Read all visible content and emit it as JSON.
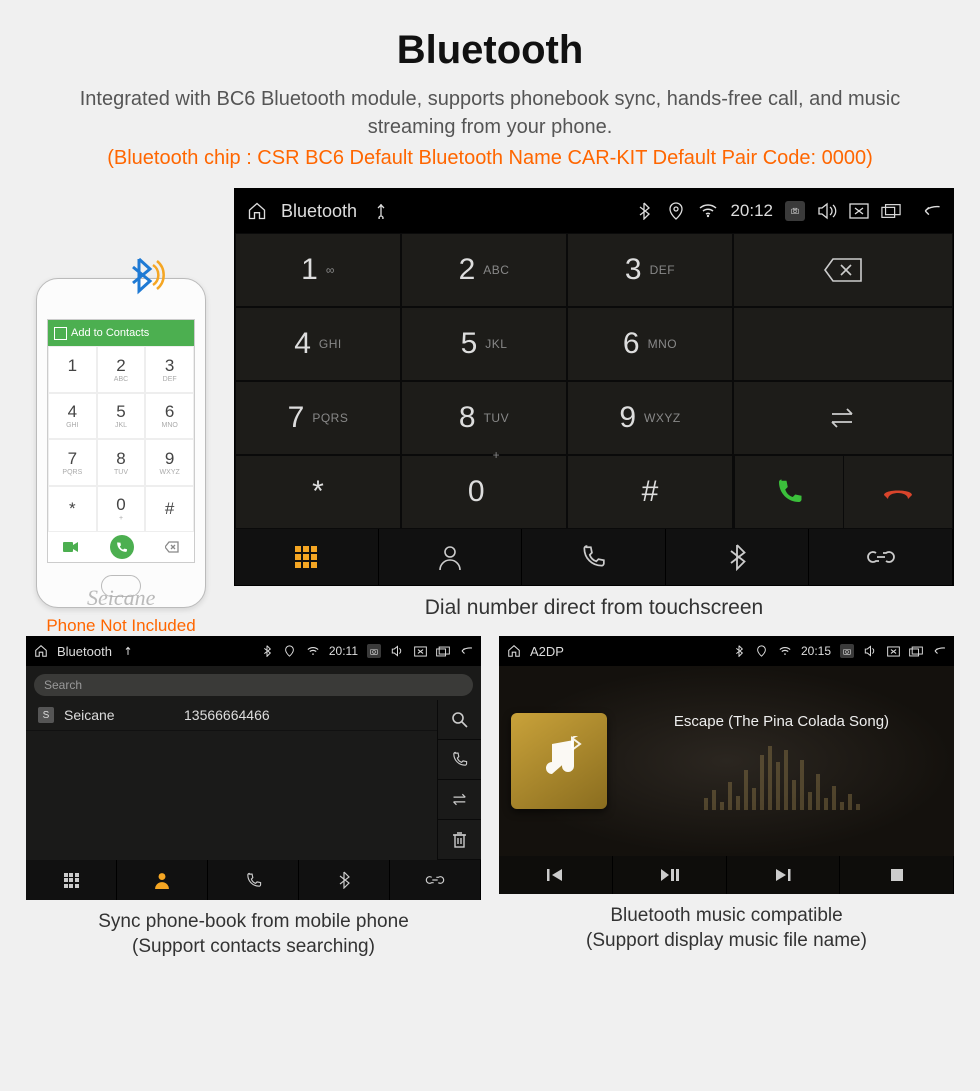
{
  "header": {
    "title": "Bluetooth",
    "description": "Integrated with BC6 Bluetooth module, supports phonebook sync, hands-free call, and music streaming from your phone.",
    "specs": "(Bluetooth chip : CSR BC6     Default Bluetooth Name CAR-KIT     Default Pair Code: 0000)"
  },
  "phone": {
    "topbar_label": "Add to Contacts",
    "caption": "Phone Not Included",
    "watermark": "Seicane"
  },
  "dialer": {
    "status": {
      "title": "Bluetooth",
      "time": "20:12"
    },
    "keys": [
      {
        "num": "1",
        "lbl": "∞"
      },
      {
        "num": "2",
        "lbl": "ABC"
      },
      {
        "num": "3",
        "lbl": "DEF"
      },
      {
        "num": "4",
        "lbl": "GHI"
      },
      {
        "num": "5",
        "lbl": "JKL"
      },
      {
        "num": "6",
        "lbl": "MNO"
      },
      {
        "num": "7",
        "lbl": "PQRS"
      },
      {
        "num": "8",
        "lbl": "TUV"
      },
      {
        "num": "9",
        "lbl": "WXYZ"
      },
      {
        "num": "*",
        "lbl": ""
      },
      {
        "num": "0",
        "lbl": "+"
      },
      {
        "num": "#",
        "lbl": ""
      }
    ],
    "caption": "Dial number direct from touchscreen"
  },
  "phonebook": {
    "status": {
      "title": "Bluetooth",
      "time": "20:11"
    },
    "search_placeholder": "Search",
    "contacts": [
      {
        "initial": "S",
        "name": "Seicane",
        "number": "13566664466"
      }
    ],
    "caption_line1": "Sync phone-book from mobile phone",
    "caption_line2": "(Support contacts searching)"
  },
  "music": {
    "status": {
      "title": "A2DP",
      "time": "20:15"
    },
    "song": "Escape (The Pina Colada Song)",
    "caption_line1": "Bluetooth music compatible",
    "caption_line2": "(Support display music file name)"
  },
  "colors": {
    "accent": "#ff6600",
    "call_green": "#3bbf3b",
    "hangup_red": "#d8442b",
    "tab_active": "#f5a623"
  }
}
